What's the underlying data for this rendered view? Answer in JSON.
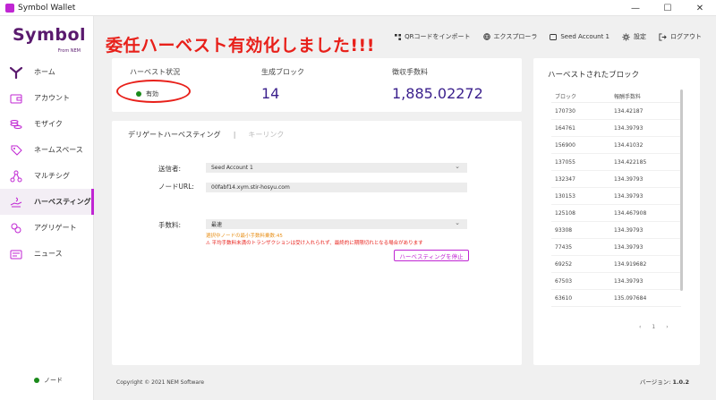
{
  "window": {
    "title": "Symbol Wallet",
    "controls": [
      "—",
      "☐",
      "✕"
    ]
  },
  "logo": {
    "word": "Symbol",
    "from": "From NEM"
  },
  "sidebar": {
    "items": [
      {
        "label": "ホーム",
        "icon": "home-icon"
      },
      {
        "label": "アカウント",
        "icon": "account-icon"
      },
      {
        "label": "モザイク",
        "icon": "mosaic-icon"
      },
      {
        "label": "ネームスペース",
        "icon": "namespace-icon"
      },
      {
        "label": "マルチシグ",
        "icon": "multisig-icon"
      },
      {
        "label": "ハーベスティング",
        "icon": "harvesting-icon",
        "active": true
      },
      {
        "label": "アグリゲート",
        "icon": "aggregate-icon"
      },
      {
        "label": "ニュース",
        "icon": "news-icon"
      }
    ],
    "node_status": "ノード"
  },
  "heading": "委任ハーベスト有効化しました!!!",
  "topbar": {
    "qr_import": "QRコードをインポート",
    "explorer": "エクスプローラ",
    "account": "Seed Account 1",
    "settings": "設定",
    "logout": "ログアウト"
  },
  "stats": {
    "status_label": "ハーベスト状況",
    "status_value": "有効",
    "blocks_label": "生成ブロック",
    "blocks_value": "14",
    "fees_label": "徴収手数料",
    "fees_value": "1,885.02272"
  },
  "form": {
    "tab_active": "デリゲートハーベスティング",
    "tab_separator": "|",
    "tab_inactive": "キーリンク",
    "sender_label": "送信者:",
    "sender_value": "Seed Account 1",
    "node_url_label": "ノードURL:",
    "node_url_value": "00fabf14.xym.stir-hosyu.com",
    "fee_label": "手数料:",
    "fee_value": "最速",
    "hint_min_fee": "選択中ノードの最小手数料乗数:45",
    "hint_warning": "⚠ 平均手数料未満のトランザクションは受け入れられず、最終的に期限切れとなる場合があります",
    "stop_button": "ハーベスティングを停止"
  },
  "blocks": {
    "title": "ハーベストされたブロック",
    "col_block": "ブロック",
    "col_fee": "報酬手数料",
    "rows": [
      {
        "block": "170730",
        "fee": "134.42187"
      },
      {
        "block": "164761",
        "fee": "134.39793"
      },
      {
        "block": "156900",
        "fee": "134.41032"
      },
      {
        "block": "137055",
        "fee": "134.422185"
      },
      {
        "block": "132347",
        "fee": "134.39793"
      },
      {
        "block": "130153",
        "fee": "134.39793"
      },
      {
        "block": "125108",
        "fee": "134.467908"
      },
      {
        "block": "93308",
        "fee": "134.39793"
      },
      {
        "block": "77435",
        "fee": "134.39793"
      },
      {
        "block": "69252",
        "fee": "134.919682"
      },
      {
        "block": "67503",
        "fee": "134.39793"
      },
      {
        "block": "63610",
        "fee": "135.097684"
      }
    ],
    "pager_prev": "‹",
    "pager_page": "1",
    "pager_next": "›"
  },
  "footer": {
    "copyright": "Copyright © 2021 NEM Software",
    "version_label": "バージョン: ",
    "version_value": "1.0.2"
  },
  "colors": {
    "accent": "#c026d3",
    "heading": "#e8201a",
    "stat_value": "#3a1f8c",
    "status_ok": "#1a8a1a"
  }
}
